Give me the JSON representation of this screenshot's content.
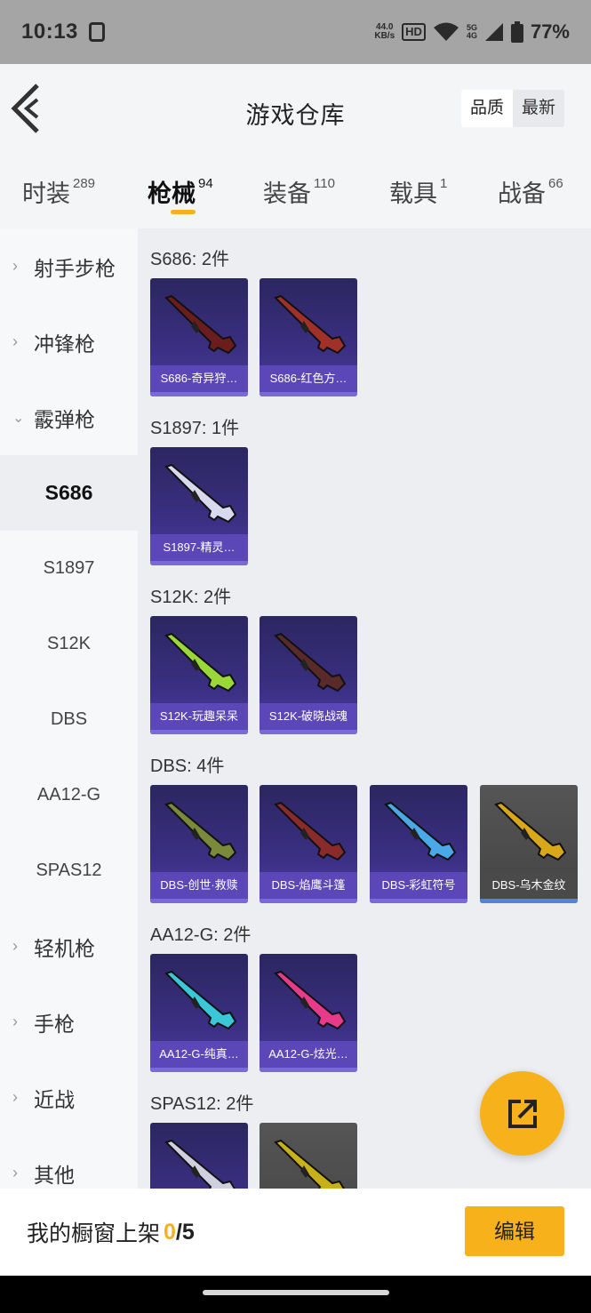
{
  "status_bar": {
    "time": "10:13",
    "speed_value": "44.0",
    "speed_unit": "KB/s",
    "hd_label": "HD",
    "network_top": "5G",
    "network_bottom": "4G",
    "battery": "77%"
  },
  "header": {
    "title": "游戏仓库",
    "sort_options": [
      "品质",
      "最新"
    ],
    "active_sort": "品质"
  },
  "tabs": [
    {
      "label": "时装",
      "count": "289"
    },
    {
      "label": "枪械",
      "count": "94"
    },
    {
      "label": "装备",
      "count": "110"
    },
    {
      "label": "载具",
      "count": "1"
    },
    {
      "label": "战备",
      "count": "66"
    }
  ],
  "active_tab": "枪械",
  "sidebar": {
    "items": [
      {
        "label": "射手步枪",
        "type": "category",
        "expanded": false
      },
      {
        "label": "冲锋枪",
        "type": "category",
        "expanded": false
      },
      {
        "label": "霰弹枪",
        "type": "category",
        "expanded": true
      },
      {
        "label": "S686",
        "type": "sub",
        "active": true
      },
      {
        "label": "S1897",
        "type": "sub"
      },
      {
        "label": "S12K",
        "type": "sub"
      },
      {
        "label": "DBS",
        "type": "sub"
      },
      {
        "label": "AA12-G",
        "type": "sub"
      },
      {
        "label": "SPAS12",
        "type": "sub"
      },
      {
        "label": "轻机枪",
        "type": "category",
        "expanded": false
      },
      {
        "label": "手枪",
        "type": "category",
        "expanded": false
      },
      {
        "label": "近战",
        "type": "category",
        "expanded": false
      },
      {
        "label": "其他",
        "type": "category",
        "expanded": false
      }
    ]
  },
  "sections": [
    {
      "title": "S686: 2件",
      "items": [
        {
          "label": "S686-奇异狩…",
          "color": "#6b1d1d",
          "rarity": "purple"
        },
        {
          "label": "S686-红色方…",
          "color": "#a0302a",
          "rarity": "purple"
        }
      ]
    },
    {
      "title": "S1897: 1件",
      "items": [
        {
          "label": "S1897-精灵…",
          "color": "#d8d8ee",
          "rarity": "purple"
        }
      ]
    },
    {
      "title": "S12K: 2件",
      "items": [
        {
          "label": "S12K-玩趣呆呆",
          "color": "#9ad83a",
          "rarity": "purple"
        },
        {
          "label": "S12K-破晓战魂",
          "color": "#5a2a2a",
          "rarity": "purple"
        }
      ]
    },
    {
      "title": "DBS: 4件",
      "items": [
        {
          "label": "DBS-创世·救赎",
          "color": "#7a8a3a",
          "rarity": "purple"
        },
        {
          "label": "DBS-焰鹰斗篷",
          "color": "#8a2a2a",
          "rarity": "purple"
        },
        {
          "label": "DBS-彩虹符号",
          "color": "#4aa8e8",
          "rarity": "purple"
        },
        {
          "label": "DBS-乌木金纹",
          "color": "#d8a81a",
          "rarity": "gold"
        }
      ]
    },
    {
      "title": "AA12-G: 2件",
      "items": [
        {
          "label": "AA12-G-纯真…",
          "color": "#3ac8d8",
          "rarity": "purple"
        },
        {
          "label": "AA12-G-炫光…",
          "color": "#e83a8a",
          "rarity": "purple"
        }
      ]
    },
    {
      "title": "SPAS12: 2件",
      "items": [
        {
          "label": "",
          "color": "#cfcfdf",
          "rarity": "purple"
        },
        {
          "label": "",
          "color": "#c8b01a",
          "rarity": "gold"
        }
      ]
    }
  ],
  "footer": {
    "title": "我的橱窗上架",
    "listed": "0",
    "slash": "/",
    "total": "5",
    "edit_label": "编辑"
  },
  "colors": {
    "accent": "#f7b21b",
    "card_purple": "#3a2f82",
    "card_label": "#5b47b7"
  }
}
